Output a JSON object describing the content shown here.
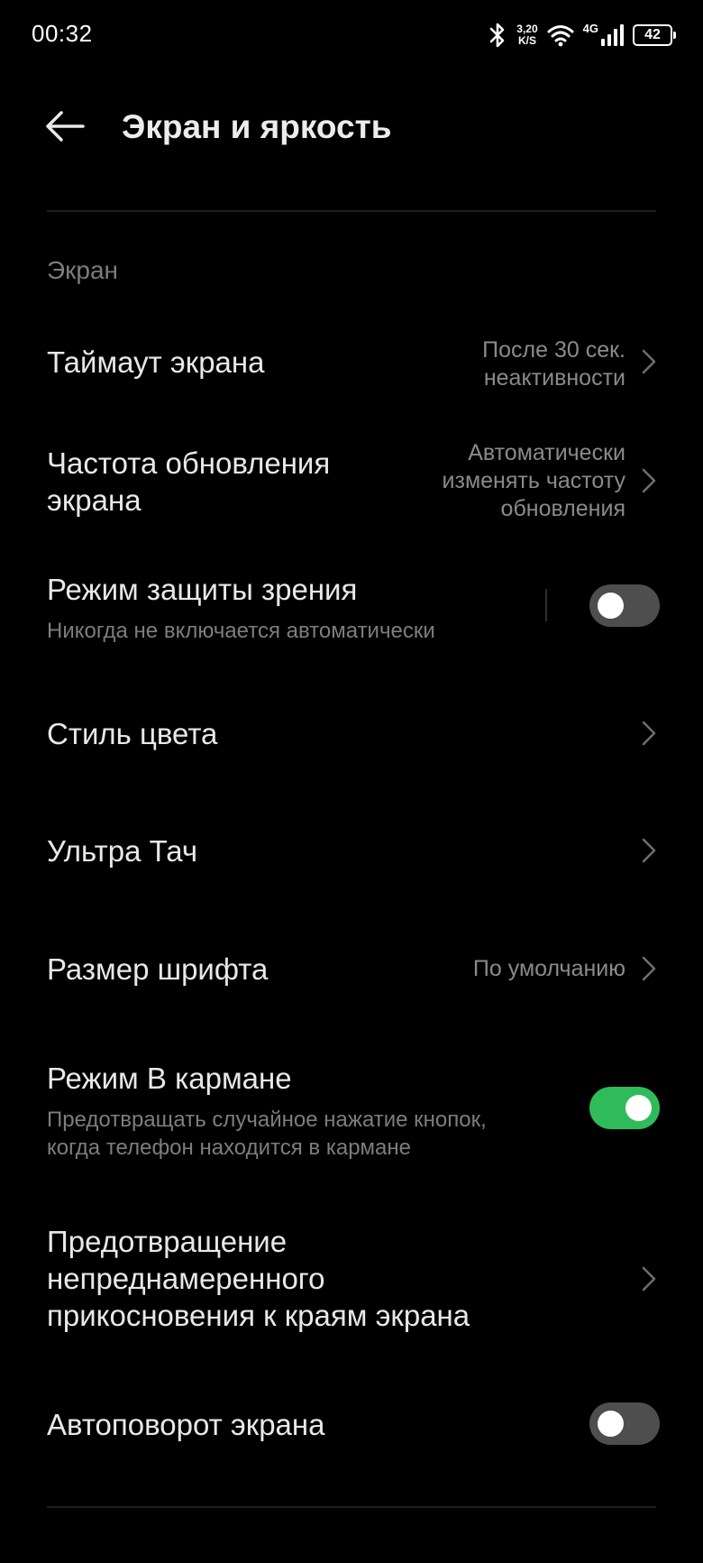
{
  "status_bar": {
    "time": "00:32",
    "speed_value": "3,20",
    "speed_unit": "K/S",
    "network_type": "4G",
    "battery_level": "42"
  },
  "header": {
    "title": "Экран и яркость",
    "back_icon": "arrow-left-icon"
  },
  "section": {
    "title": "Экран"
  },
  "rows": {
    "screen_timeout": {
      "title": "Таймаут экрана",
      "value": "После 30 сек.\nнеактивности"
    },
    "refresh_rate": {
      "title_line1": "Частота обновления",
      "title_line2": "экрана",
      "value": "Автоматически\nизменять частоту\nобновления"
    },
    "eye_comfort": {
      "title": "Режим защиты зрения",
      "subtitle": "Никогда не включается автоматически",
      "enabled": false
    },
    "color_style": {
      "title": "Стиль цвета"
    },
    "ultra_touch": {
      "title": "Ультра Тач"
    },
    "font_size": {
      "title": "Размер шрифта",
      "value": "По умолчанию"
    },
    "pocket_mode": {
      "title": "Режим В кармане",
      "subtitle_line1": "Предотвращать случайное нажатие кнопок,",
      "subtitle_line2": "когда телефон находится в кармане",
      "enabled": true
    },
    "edge_touch": {
      "title_line1": "Предотвращение",
      "title_line2": "непреднамеренного",
      "title_line3": "прикосновения к краям экрана"
    },
    "auto_rotate": {
      "title": "Автоповорот экрана",
      "enabled": false
    }
  },
  "colors": {
    "background": "#000000",
    "toggle_on": "#2fbb5a",
    "toggle_off": "#4e4e4e"
  }
}
